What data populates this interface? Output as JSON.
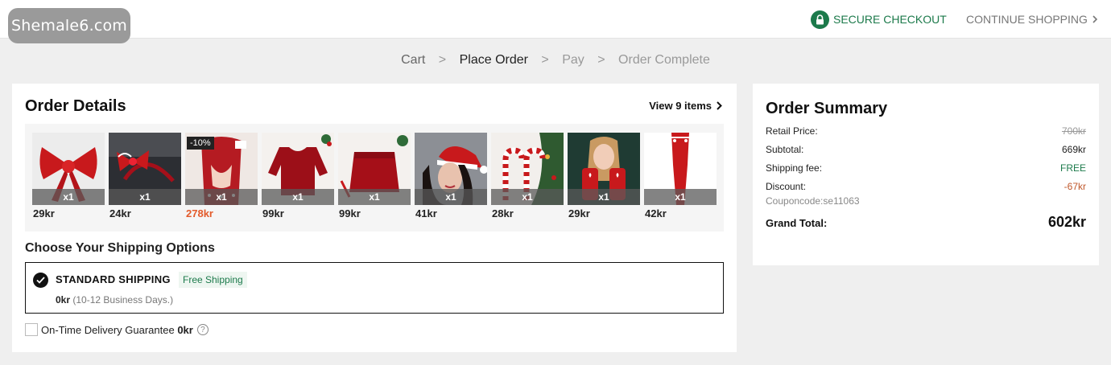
{
  "header": {
    "logo_text": "Shemale6.com",
    "secure_label": "SECURE CHECKOUT",
    "continue_label": "CONTINUE SHOPPING",
    "accent_color": "#1c7a4b"
  },
  "breadcrumb": {
    "steps": [
      "Cart",
      "Place Order",
      "Pay",
      "Order Complete"
    ],
    "separator": ">",
    "active": "Place Order"
  },
  "order_details": {
    "title": "Order Details",
    "view_items_label": "View 9 items",
    "items": [
      {
        "qty": "x1",
        "price": "29kr",
        "desc": "red glitter bow"
      },
      {
        "qty": "x1",
        "price": "24kr",
        "desc": "red sequin bow headband"
      },
      {
        "qty": "x1",
        "price": "278kr",
        "discount": "-10%",
        "sale": true,
        "desc": "red santa dress"
      },
      {
        "qty": "x1",
        "price": "99kr",
        "desc": "red velvet top"
      },
      {
        "qty": "x1",
        "price": "99kr",
        "desc": "red velvet skirt"
      },
      {
        "qty": "x1",
        "price": "41kr",
        "desc": "santa hat model"
      },
      {
        "qty": "x1",
        "price": "28kr",
        "desc": "candy cane earrings"
      },
      {
        "qty": "x1",
        "price": "29kr",
        "desc": "red heart gloves"
      },
      {
        "qty": "x1",
        "price": "42kr",
        "desc": "red thigh high stockings"
      }
    ]
  },
  "shipping": {
    "title": "Choose Your Shipping Options",
    "option_name": "STANDARD SHIPPING",
    "badge": "Free Shipping",
    "cost": "0kr",
    "days": "(10-12 Business Days.)",
    "guarantee_label": "On-Time Delivery Guarantee",
    "guarantee_price": "0kr"
  },
  "summary": {
    "title": "Order Summary",
    "retail_label": "Retail Price:",
    "retail_value": "700kr",
    "subtotal_label": "Subtotal:",
    "subtotal_value": "669kr",
    "shipping_label": "Shipping fee:",
    "shipping_value": "FREE",
    "discount_label": "Discount:",
    "discount_value": "-67kr",
    "coupon_text": "Couponcode:se11063",
    "grand_label": "Grand Total:",
    "grand_value": "602kr"
  }
}
